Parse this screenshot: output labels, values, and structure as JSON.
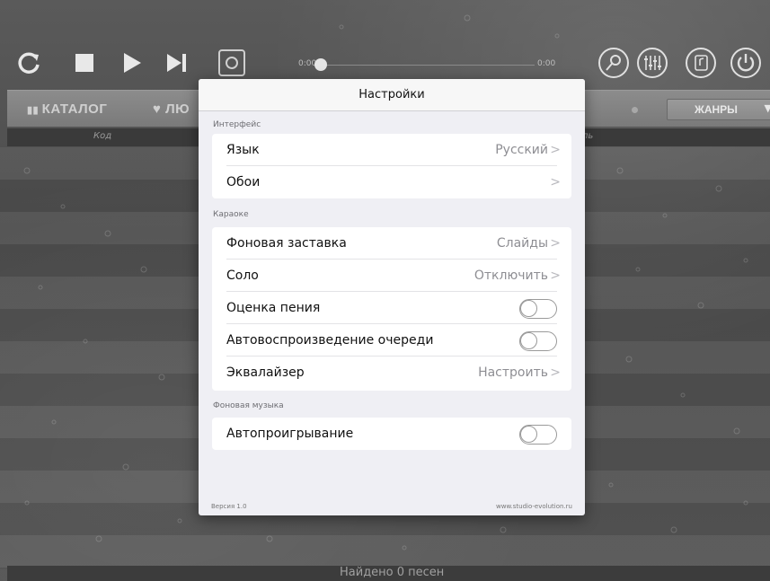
{
  "player": {
    "time_start": "0:00",
    "time_end": "0:00",
    "progress": 0
  },
  "categories": {
    "catalog": "КАТАЛОГ",
    "favorites": "ЛЮ",
    "genres": "ЖАНРЫ"
  },
  "columns": {
    "code": "Код",
    "artist_partial": "ль"
  },
  "footer": {
    "found": "Найдено 0 песен"
  },
  "settings": {
    "title": "Настройки",
    "sections": {
      "interface": "Интерфейс",
      "karaoke": "Караоке",
      "background_music": "Фоновая музыка"
    },
    "language": {
      "label": "Язык",
      "value": "Русский"
    },
    "wallpaper": {
      "label": "Обои",
      "value": ""
    },
    "screensaver": {
      "label": "Фоновая заставка",
      "value": "Слайды"
    },
    "solo": {
      "label": "Соло",
      "value": "Отключить"
    },
    "singing_score": {
      "label": "Оценка пения",
      "on": false
    },
    "queue_autoplay": {
      "label": "Автовоспроизведение очереди",
      "on": false
    },
    "equalizer": {
      "label": "Эквалайзер",
      "value": "Настроить"
    },
    "autoplay": {
      "label": "Автопроигрывание",
      "on": false
    },
    "version": "Версия 1.0",
    "website": "www.studio-evolution.ru"
  },
  "colors": {
    "modal_bg": "#efeff4",
    "toggle_off": "#9a9a9a",
    "value_gray": "#8e8e93"
  }
}
